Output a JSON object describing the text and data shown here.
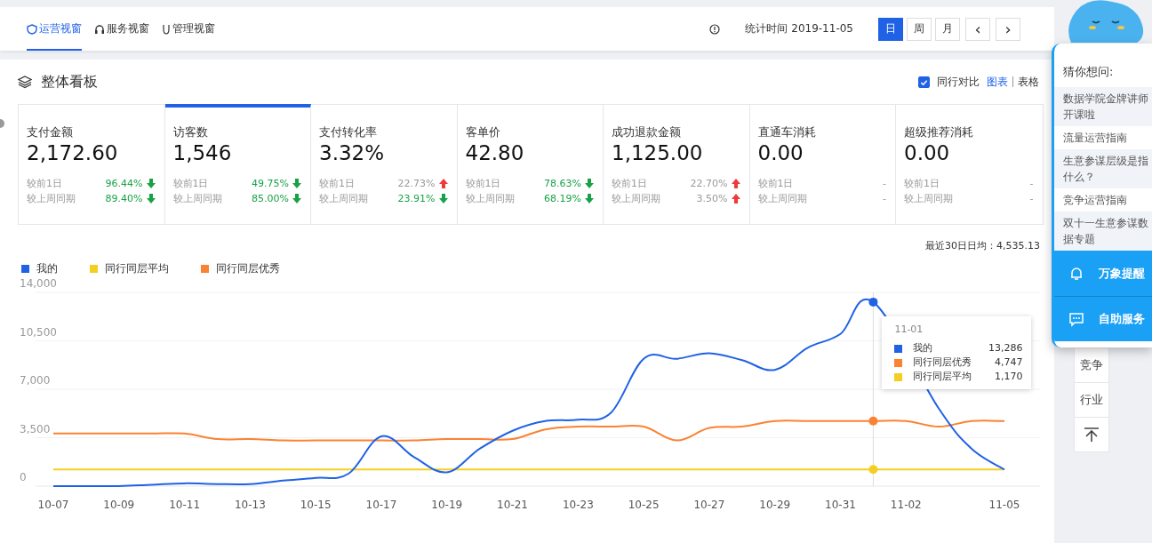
{
  "nav": {
    "tabs": [
      {
        "label": "运营视窗",
        "selected": true
      },
      {
        "label": "服务视窗",
        "selected": false
      },
      {
        "label": "管理视窗",
        "selected": false
      }
    ],
    "stat_time": "统计时间 2019-11-05",
    "periods": [
      {
        "label": "日",
        "selected": true
      },
      {
        "label": "周",
        "selected": false
      },
      {
        "label": "月",
        "selected": false
      }
    ],
    "pager": [
      "‹",
      "›"
    ]
  },
  "board": {
    "title": "整体看板",
    "compare": {
      "label": "同行对比",
      "checked": true
    },
    "views": [
      {
        "label": "图表",
        "selected": true
      },
      {
        "label": "表格",
        "selected": false
      }
    ],
    "metrics": [
      {
        "label": "支付金额",
        "value": "2,172.60",
        "selected": false,
        "comparisons": [
          {
            "label": "较前1日",
            "change": "96.44%",
            "kind": "down"
          },
          {
            "label": "较上周同期",
            "change": "89.40%",
            "kind": "down"
          }
        ]
      },
      {
        "label": "访客数",
        "value": "1,546",
        "selected": true,
        "comparisons": [
          {
            "label": "较前1日",
            "change": "49.75%",
            "kind": "down"
          },
          {
            "label": "较上周同期",
            "change": "85.00%",
            "kind": "down"
          }
        ]
      },
      {
        "label": "支付转化率",
        "value": "3.32%",
        "selected": false,
        "comparisons": [
          {
            "label": "较前1日",
            "change": "22.73%",
            "kind": "up"
          },
          {
            "label": "较上周同期",
            "change": "23.91%",
            "kind": "down"
          }
        ]
      },
      {
        "label": "客单价",
        "value": "42.80",
        "selected": false,
        "comparisons": [
          {
            "label": "较前1日",
            "change": "78.63%",
            "kind": "down"
          },
          {
            "label": "较上周同期",
            "change": "68.19%",
            "kind": "down"
          }
        ]
      },
      {
        "label": "成功退款金额",
        "value": "1,125.00",
        "selected": false,
        "comparisons": [
          {
            "label": "较前1日",
            "change": "22.70%",
            "kind": "up"
          },
          {
            "label": "较上周同期",
            "change": "3.50%",
            "kind": "up"
          }
        ]
      },
      {
        "label": "直通车消耗",
        "value": "0.00",
        "selected": false,
        "comparisons": [
          {
            "label": "较前1日",
            "change": "-",
            "kind": "none"
          },
          {
            "label": "较上周同期",
            "change": "-",
            "kind": "none"
          }
        ]
      },
      {
        "label": "超级推荐消耗",
        "value": "0.00",
        "selected": false,
        "comparisons": [
          {
            "label": "较前1日",
            "change": "-",
            "kind": "none"
          },
          {
            "label": "较上周同期",
            "change": "-",
            "kind": "none"
          }
        ]
      }
    ],
    "average": "最近30日日均：4,535.13",
    "chart_data": {
      "type": "line",
      "categories": [
        "10-07",
        null,
        "10-09",
        null,
        "10-11",
        null,
        "10-13",
        null,
        "10-15",
        null,
        "10-17",
        null,
        "10-19",
        null,
        "10-21",
        null,
        "10-23",
        null,
        "10-25",
        null,
        "10-27",
        null,
        "10-29",
        null,
        "10-31",
        null,
        "11-02",
        null,
        null,
        "11-05"
      ],
      "series": [
        {
          "name": "我的",
          "color": "#2062e6",
          "values": [
            0,
            0,
            0,
            100,
            200,
            150,
            150,
            400,
            600,
            900,
            3600,
            2100,
            1000,
            2700,
            4000,
            4700,
            4800,
            5300,
            9200,
            9200,
            9600,
            9100,
            8400,
            10000,
            11000,
            13300,
            null,
            5600,
            2700,
            1200
          ]
        },
        {
          "name": "同行同层平均",
          "color": "#f5cf1f",
          "values": [
            1200,
            1200,
            1200,
            1200,
            1200,
            1200,
            1200,
            1200,
            1200,
            1200,
            1200,
            1200,
            1200,
            1200,
            1200,
            1200,
            1200,
            1200,
            1200,
            1200,
            1200,
            1200,
            1200,
            1200,
            1200,
            1200,
            1200,
            1200,
            1200,
            1200
          ]
        },
        {
          "name": "同行同层优秀",
          "color": "#fb8232",
          "values": [
            3800,
            3800,
            3800,
            3800,
            3800,
            3400,
            3400,
            3300,
            3300,
            3300,
            3300,
            3300,
            3400,
            3400,
            3400,
            4100,
            4300,
            4300,
            4300,
            3300,
            4200,
            4300,
            4700,
            4700,
            4700,
            4700,
            4700,
            4300,
            4700,
            4700
          ]
        }
      ],
      "ylim": [
        0,
        14000
      ],
      "yticks": [
        0,
        {
          "value": 3500,
          "label": "3,500"
        },
        {
          "value": 7000,
          "label": "7,000"
        },
        {
          "value": 10500,
          "label": "10,500"
        },
        {
          "value": 14000,
          "label": "14,000"
        }
      ],
      "grid": true,
      "legend": "top-left"
    },
    "tooltip": {
      "title": "11-01",
      "rows": [
        {
          "name": "我的",
          "value": "13,286",
          "color": "#2062e6"
        },
        {
          "name": "同行同层优秀",
          "value": "4,747",
          "color": "#fb8232"
        },
        {
          "name": "同行同层平均",
          "value": "1,170",
          "color": "#f5cf1f"
        }
      ]
    }
  },
  "rail": {
    "items": [
      {
        "label": "竞争",
        "kind": "text"
      },
      {
        "label": "行业",
        "kind": "text"
      },
      {
        "kind": "top"
      }
    ]
  },
  "assistant": {
    "title": "猜你想问:",
    "questions": [
      "数据学院金牌讲师开课啦",
      "流量运营指南",
      "生意参谋层级是指什么？",
      "竞争运营指南",
      "双十一生意参谋数据专题"
    ],
    "actions": [
      {
        "label": "万象提醒"
      },
      {
        "label": "自助服务"
      }
    ]
  }
}
